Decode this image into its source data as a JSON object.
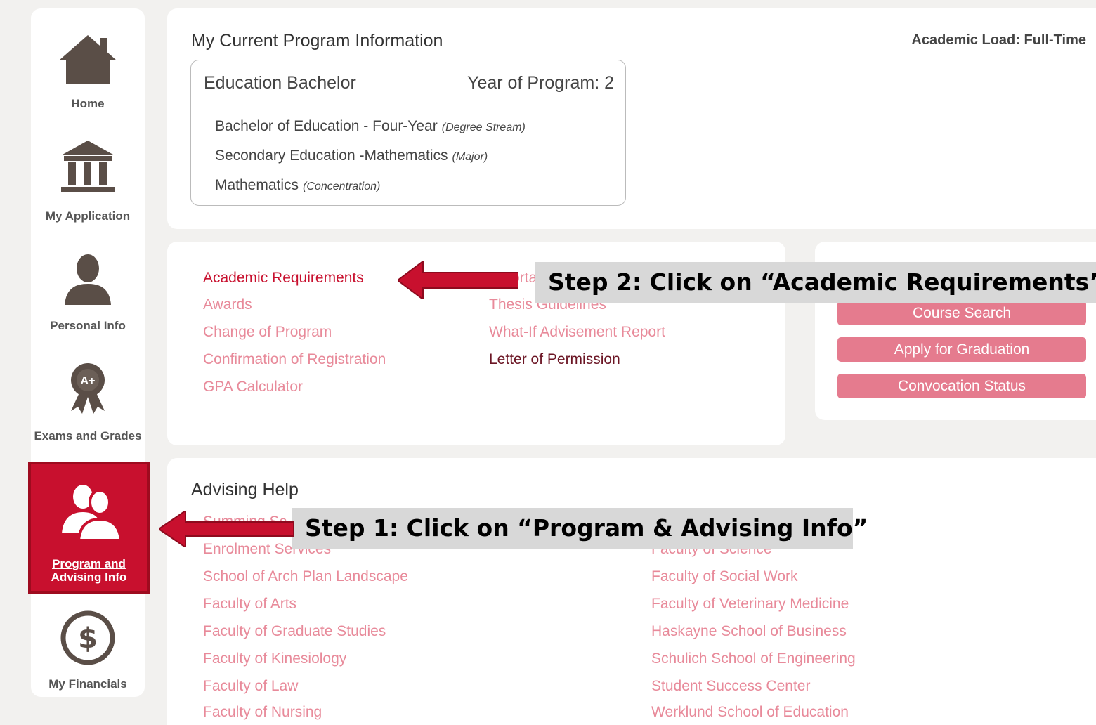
{
  "sidebar": {
    "items": [
      {
        "label": "Home",
        "icon": "home-icon"
      },
      {
        "label": "My Application",
        "icon": "building-icon"
      },
      {
        "label": "Personal Info",
        "icon": "person-icon"
      },
      {
        "label": "Exams and Grades",
        "icon": "award-ribbon-icon"
      },
      {
        "label": "Program and Advising Info",
        "icon": "users-icon"
      },
      {
        "label": "My Financials",
        "icon": "dollar-icon"
      }
    ]
  },
  "program": {
    "heading": "My Current Program Information",
    "academic_load": "Academic Load: Full-Time",
    "title": "Education Bachelor",
    "year": "Year of Program: 2",
    "rows": [
      {
        "text": "Bachelor of Education - Four-Year",
        "note": "(Degree Stream)"
      },
      {
        "text": "Secondary Education -Mathematics",
        "note": "(Major)"
      },
      {
        "text": "Mathematics",
        "note": "(Concentration)"
      }
    ]
  },
  "links": {
    "col1": [
      "Academic Requirements",
      "Awards",
      "Change of Program",
      "Confirmation of Registration",
      "GPA Calculator"
    ],
    "col2_partial_top": "ortant",
    "col2": [
      "Thesis Guidelines",
      "What-If Advisement Report",
      "Letter of Permission"
    ]
  },
  "buttons": [
    "Course Search",
    "Apply for Graduation",
    "Convocation Status"
  ],
  "advising": {
    "heading": "Advising Help",
    "partial_first": "Summing Sc",
    "col1": [
      "Enrolment Services",
      "School of Arch Plan Landscape",
      "Faculty of Arts",
      "Faculty of Graduate Studies",
      "Faculty of Kinesiology",
      "Faculty of Law",
      "Faculty of Nursing"
    ],
    "col2": [
      "Faculty of Science",
      "Faculty of Social Work",
      "Faculty of Veterinary Medicine",
      "Haskayne School of Business",
      "Schulich School of Engineering",
      "Student Success Center",
      "Werklund School of Education"
    ]
  },
  "callouts": {
    "step1": "Step 1: Click on “Program & Advising Info”",
    "step2": "Step 2: Click on “Academic Requirements”"
  },
  "colors": {
    "accent": "#c8102e",
    "link": "#e88a9a",
    "button": "#e57b8e",
    "icon": "#5a4e47"
  }
}
